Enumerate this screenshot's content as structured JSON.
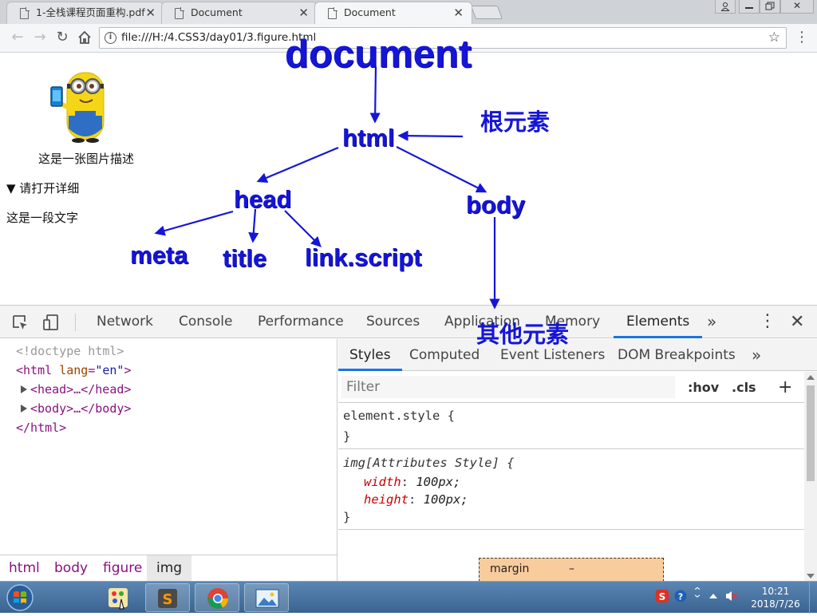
{
  "browser": {
    "tabs": [
      {
        "title": "1-全栈课程页面重构.pdf",
        "active": false
      },
      {
        "title": "Document",
        "active": false
      },
      {
        "title": "Document",
        "active": true
      }
    ],
    "url": "file:///H:/4.CSS3/day01/3.figure.html",
    "window_buttons": [
      "user-icon",
      "minimize-icon",
      "restore-icon",
      "close-icon"
    ]
  },
  "page": {
    "figcaption": "这是一张图片描述",
    "details_summary": "▼ 请打开详细",
    "paragraph": "这是一段文字"
  },
  "diagram": {
    "document": "document",
    "html": "html",
    "root_label": "根元素",
    "head": "head",
    "body": "body",
    "meta": "meta",
    "title": "title",
    "link_script": "link.script",
    "other_label": "其他元素",
    "color": "#1515d8"
  },
  "devtools": {
    "tabs": [
      "Network",
      "Console",
      "Performance",
      "Sources",
      "Application",
      "Memory",
      "Elements"
    ],
    "active_tab": "Elements",
    "dom": {
      "doctype": "<!doctype html>",
      "html_open_tag": "html",
      "html_attr_name": "lang",
      "html_attr_value": "\"en\"",
      "head_collapsed": "<head>…</head>",
      "body_collapsed": "<body>…</body>",
      "html_close": "</html>"
    },
    "breadcrumbs": [
      "html",
      "body",
      "figure",
      "img"
    ],
    "styles_tabs": [
      "Styles",
      "Computed",
      "Event Listeners",
      "DOM Breakpoints"
    ],
    "filter_placeholder": "Filter",
    "hov": ":hov",
    "cls": ".cls",
    "plus": "+",
    "rules": {
      "element_style": "element.style {",
      "close_brace": "}",
      "img_selector": "img[Attributes Style] {",
      "width_name": "width",
      "width_value": "100px;",
      "height_name": "height",
      "height_value": "100px;"
    },
    "boxmodel_label": "margin",
    "boxmodel_value": "–"
  },
  "taskbar": {
    "time": "10:21",
    "date": "2018/7/26",
    "apps": [
      "paint-icon",
      "sublime-text-icon",
      "chrome-icon",
      "photo-viewer-icon"
    ]
  }
}
